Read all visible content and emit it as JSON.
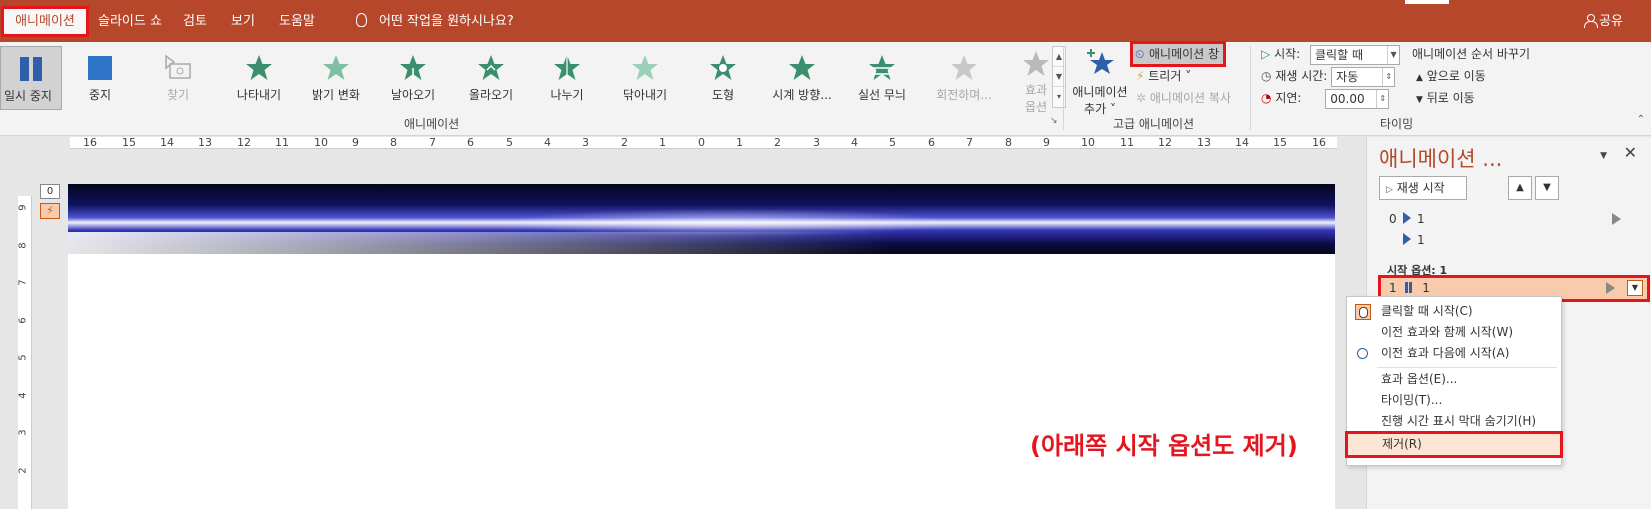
{
  "tabs": {
    "animation": "애니메이션",
    "slideshow": "슬라이드 쇼",
    "review": "검토",
    "view": "보기",
    "help": "도움말",
    "tell_me": "어떤 작업을 원하시나요?",
    "share": "공유"
  },
  "gallery": {
    "items": [
      {
        "label": "일시 중지",
        "icon": "pause-icon",
        "state": "selected"
      },
      {
        "label": "중지",
        "icon": "stop-square-icon",
        "state": "normal"
      },
      {
        "label": "찾기",
        "icon": "seek-icon",
        "state": "disabled"
      },
      {
        "label": "나타내기",
        "icon": "appear-star-icon",
        "state": "normal"
      },
      {
        "label": "밝기 변화",
        "icon": "fade-star-icon",
        "state": "normal"
      },
      {
        "label": "날아오기",
        "icon": "fly-in-star-icon",
        "state": "normal"
      },
      {
        "label": "올라오기",
        "icon": "float-in-star-icon",
        "state": "normal"
      },
      {
        "label": "나누기",
        "icon": "split-star-icon",
        "state": "normal"
      },
      {
        "label": "닦아내기",
        "icon": "wipe-star-icon",
        "state": "normal"
      },
      {
        "label": "도형",
        "icon": "shape-star-icon",
        "state": "normal"
      },
      {
        "label": "시계 방향...",
        "icon": "wheel-star-icon",
        "state": "normal"
      },
      {
        "label": "실선 무늬",
        "icon": "random-bars-star-icon",
        "state": "normal"
      },
      {
        "label": "회전하며...",
        "icon": "grow-turn-star-icon",
        "state": "disabled"
      }
    ],
    "effect_options_line1": "효과",
    "effect_options_line2": "옵션",
    "group_label": "애니메이션"
  },
  "advanced": {
    "add_animation_line1": "애니메이션",
    "add_animation_line2": "추가",
    "animation_pane": "애니메이션 창",
    "trigger": "트리거",
    "painter": "애니메이션 복사",
    "group_label": "고급 애니메이션"
  },
  "timing": {
    "start_label": "시작:",
    "start_value": "클릭할 때",
    "duration_label": "재생 시간:",
    "duration_value": "자동",
    "delay_label": "지연:",
    "delay_value": "00.00",
    "reorder_title": "애니메이션 순서 바꾸기",
    "move_earlier": "앞으로 이동",
    "move_later": "뒤로 이동",
    "group_label": "타이밍"
  },
  "ruler": {
    "h_ticks": [
      "16",
      "15",
      "14",
      "13",
      "12",
      "11",
      "10",
      "9",
      "8",
      "7",
      "6",
      "5",
      "4",
      "3",
      "2",
      "1",
      "0",
      "1",
      "2",
      "3",
      "4",
      "5",
      "6",
      "7",
      "8",
      "9",
      "10",
      "11",
      "12",
      "13",
      "14",
      "15",
      "16"
    ],
    "v_ticks": [
      "9",
      "8",
      "7",
      "6",
      "5",
      "4",
      "3",
      "2"
    ]
  },
  "slide": {
    "seq_badge": "0",
    "trigger_badge": "⚡",
    "note": "(아래쪽 시작 옵션도 제거)"
  },
  "pane": {
    "title": "애니메이션 ...",
    "play_button": "재생 시작",
    "rows": [
      {
        "num": "0",
        "label": "1"
      },
      {
        "num": "",
        "label": "1"
      }
    ],
    "section_label": "시작 옵션: 1",
    "selected_row": {
      "num": "1",
      "label": "1"
    }
  },
  "menu": {
    "start_on_click": "클릭할 때 시작(C)",
    "with_previous": "이전 효과와 함께 시작(W)",
    "after_previous": "이전 효과 다음에 시작(A)",
    "effect_options": "효과 옵션(E)...",
    "timing": "타이밍(T)...",
    "hide_timeline": "진행 시간 표시 막대 숨기기(H)",
    "remove": "제거(R)"
  },
  "colors": {
    "accent": "#b7472a",
    "highlight": "#e3161d",
    "star_green": "#3a8f6f",
    "blue": "#2e5fa8"
  }
}
